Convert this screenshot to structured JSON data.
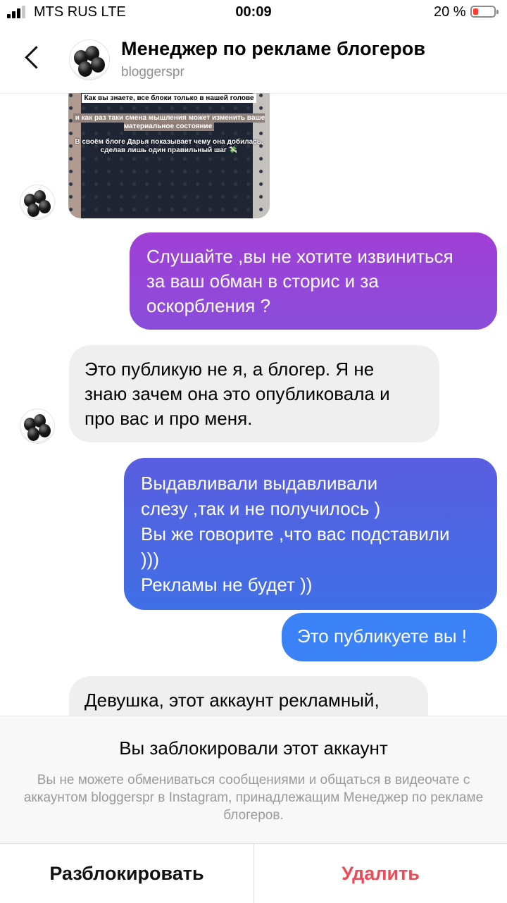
{
  "status": {
    "carrier": "MTS RUS LTE",
    "time": "00:09",
    "battery": "20 %",
    "battery_level": 0.2
  },
  "header": {
    "title": "Менеджер по рекламе блогеров",
    "username": "bloggerspr"
  },
  "story": {
    "line1": "Как вы знаете, все блоки только в нашей голове",
    "line2": "и как раз таки смена мышления может изменить ваше материальное состояние",
    "line3": "В своём блоге Дарья показывает чему она добилась, сделав лишь один правильный шаг 💸"
  },
  "messages": [
    {
      "id": "m1",
      "direction": "outgoing",
      "text": "Слушайте ,вы не хотите извиниться\nза ваш обман в сторис и за\nоскорбления ?"
    },
    {
      "id": "m2",
      "direction": "incoming",
      "text": "Это публикую не я, а блогер. Я не\nзнаю зачем она это опубликовала и\nпро вас и про меня."
    },
    {
      "id": "m3",
      "direction": "outgoing",
      "text": "Выдавливали выдавливали\nслезу ,так и не получилось )\nВы же говорите ,что вас подставили\n)))\nРекламы не будет ))"
    },
    {
      "id": "m4",
      "direction": "outgoing",
      "text": "Это публикуете вы !"
    },
    {
      "id": "m5",
      "direction": "incoming",
      "text": "Девушка, этот аккаунт рекламный,"
    }
  ],
  "blocked": {
    "title": "Вы заблокировали этот аккаунт",
    "description": "Вы не можете обмениваться сообщениями и общаться в видеочате с аккаунтом bloggerspr в Instagram, принадлежащим Менеджер по рекламе блогеров.",
    "unblock_label": "Разблокировать",
    "delete_label": "Удалить"
  },
  "colors": {
    "delete": "#ed4956",
    "incoming_bubble": "#efefef",
    "outgoing_top": "#9b3fd4",
    "outgoing_bottom": "#3b82f6"
  },
  "icons": {
    "back": "chevron-left-icon",
    "avatar": "black-balloons-logo"
  }
}
